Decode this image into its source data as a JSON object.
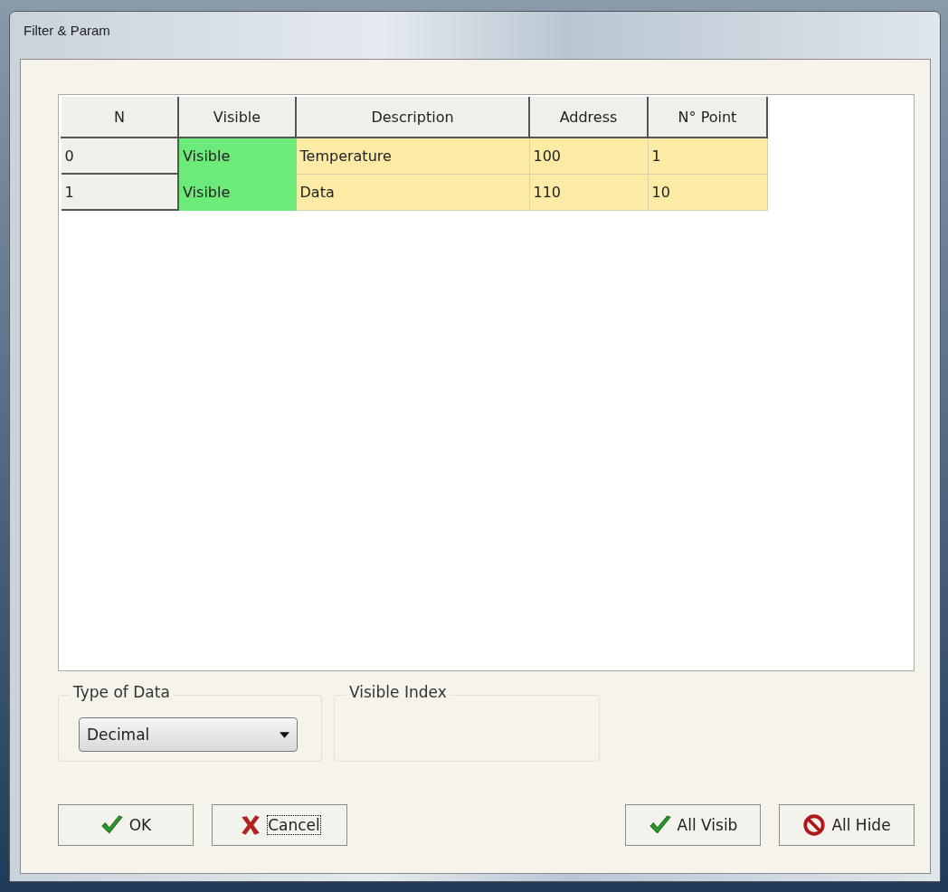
{
  "window": {
    "title": "Filter & Param"
  },
  "table": {
    "columns": [
      "N",
      "Visible",
      "Description",
      "Address",
      "N° Point"
    ],
    "rows": [
      {
        "n": "0",
        "visible": true,
        "visible_text": "Visible",
        "description": "Temperature",
        "address": "100",
        "points": "1"
      },
      {
        "n": "1",
        "visible": true,
        "visible_text": "Visible",
        "description": "Data",
        "address": "110",
        "points": "10"
      }
    ]
  },
  "type_of_data": {
    "label": "Type of Data",
    "value": "Decimal"
  },
  "visible_index": {
    "label": "Visible Index"
  },
  "buttons": [
    {
      "kind": "ok",
      "label": "OK",
      "focused": false
    },
    {
      "kind": "cancel",
      "label": "Cancel",
      "focused": true
    },
    {
      "kind": "all-visible",
      "label": "All Visib",
      "focused": false
    },
    {
      "kind": "all-hide",
      "label": "All Hide",
      "focused": false
    }
  ]
}
